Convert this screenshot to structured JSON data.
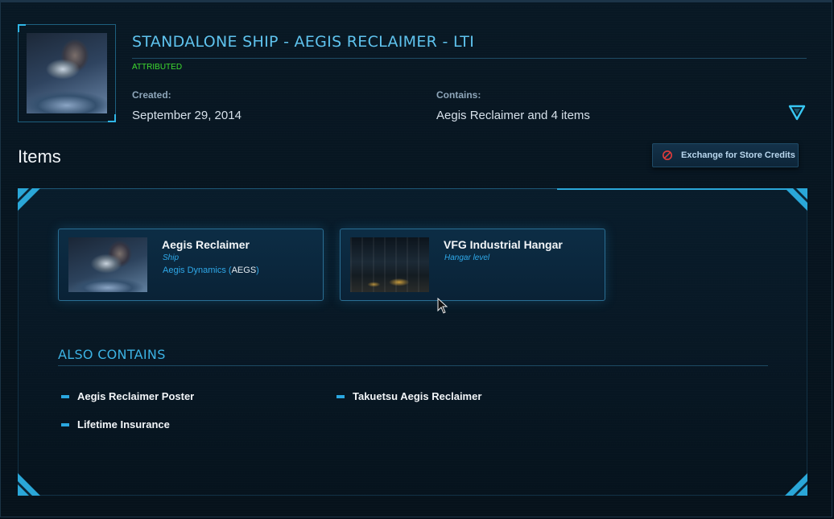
{
  "pledge": {
    "title": "STANDALONE SHIP - AEGIS RECLAIMER - LTI",
    "status_badge": "ATTRIBUTED",
    "created_label": "Created:",
    "created_value": "September 29, 2014",
    "contains_label": "Contains:",
    "contains_value": "Aegis Reclaimer and 4 items",
    "thumbnail_icon": "ship-thumbnail"
  },
  "items_section": {
    "heading": "Items",
    "exchange_button_label": "Exchange for Store Credits",
    "exchange_icon": "prohibited-icon"
  },
  "items": [
    {
      "name": "Aegis Reclaimer",
      "kind": "Ship",
      "maker": "Aegis Dynamics",
      "maker_code": "AEGS",
      "image": "ship-image"
    },
    {
      "name": "VFG Industrial Hangar",
      "kind": "Hangar level",
      "image": "hangar-image"
    }
  ],
  "also_contains": {
    "heading": "ALSO CONTAINS",
    "items": [
      "Aegis Reclaimer Poster",
      "Takuetsu Aegis Reclaimer",
      "Lifetime Insurance"
    ]
  },
  "colors": {
    "accent": "#2fa9e9",
    "title": "#5fc3ee",
    "badge_green": "#3fdc2f",
    "exchange_icon_red": "#e23b3b"
  }
}
